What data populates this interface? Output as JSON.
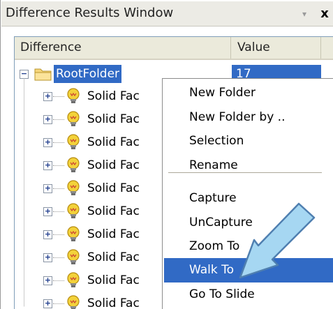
{
  "window": {
    "title": "Difference Results Window",
    "close_glyph": "x",
    "pin_glyph": "▾"
  },
  "columns": {
    "difference": "Difference",
    "value": "Value"
  },
  "tree": {
    "root": {
      "label": "RootFolder",
      "value": "17",
      "expander": "−"
    },
    "children": [
      {
        "label": "Solid Fac",
        "expander": "+"
      },
      {
        "label": "Solid Fac",
        "expander": "+"
      },
      {
        "label": "Solid Fac",
        "expander": "+"
      },
      {
        "label": "Solid Fac",
        "expander": "+"
      },
      {
        "label": "Solid Fac",
        "expander": "+"
      },
      {
        "label": "Solid Fac",
        "expander": "+"
      },
      {
        "label": "Solid Fac",
        "expander": "+"
      },
      {
        "label": "Solid Fac",
        "expander": "+"
      },
      {
        "label": "Solid Fac",
        "expander": "+"
      },
      {
        "label": "Solid Fac",
        "expander": "+"
      }
    ]
  },
  "context_menu": {
    "items": [
      {
        "label": "New Folder"
      },
      {
        "label": "New Folder by .."
      },
      {
        "label": "Selection"
      },
      {
        "label": "Rename"
      },
      {
        "label": "Capture"
      },
      {
        "label": "UnCapture"
      },
      {
        "label": "Zoom To"
      },
      {
        "label": "Walk To",
        "highlighted": true
      },
      {
        "label": "Go To Slide"
      }
    ]
  },
  "colors": {
    "selection": "#316ac5",
    "header_bg": "#ebeadb",
    "title_bg": "#ecebe5",
    "arrow_fill": "#a6d7f2",
    "arrow_stroke": "#4f7fb0",
    "bulb": "#f3d23a"
  }
}
